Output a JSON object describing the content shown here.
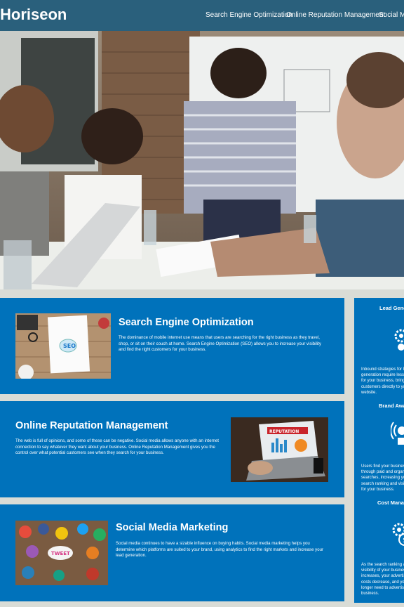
{
  "header": {
    "logo": "Horiseon",
    "nav": [
      {
        "label": "Search Engine Optimization"
      },
      {
        "label": "Online Reputation Management"
      },
      {
        "label": "Social Media Marketing"
      }
    ]
  },
  "hero": {
    "icon": "meeting-photo"
  },
  "cards": [
    {
      "title": "Search Engine Optimization",
      "text": "The dominance of mobile internet use means that users are searching for the right business as they travel, shop, or sit on their couch at home. Search Engine Optimization (SEO) allows you to increase your visibility and find the right customers for your business.",
      "image_label": "SEO"
    },
    {
      "title": "Online Reputation Management",
      "text": "The web is full of opinions, and some of these can be negative. Social media allows anyone with an internet connection to say whatever they want about your business. Online Reputation Management gives you the control over what potential customers see when they search for your business.",
      "image_label": "REPUTATION"
    },
    {
      "title": "Social Media Marketing",
      "text": "Social media continues to have a sizable influence on buying habits. Social media marketing helps you determine which platforms are suited to your brand, using analytics to find the right markets and increase your lead generation.",
      "image_label": "TWEET"
    }
  ],
  "sidebar": [
    {
      "title": "Lead Generation",
      "text": "Inbound strategies for lead generation require less work for your business, bringing customers directly to your website."
    },
    {
      "title": "Brand Awareness",
      "text": "Users find your business through paid and organic searches, increasing your search ranking and visibility for your business."
    },
    {
      "title": "Cost Management",
      "text": "As the search ranking and visibility of your business increases, your advertising costs decrease, and you no longer need to advertise your business."
    }
  ],
  "colors": {
    "header": "#2a607c",
    "card": "#0072bb",
    "page": "#d9dcd6"
  }
}
